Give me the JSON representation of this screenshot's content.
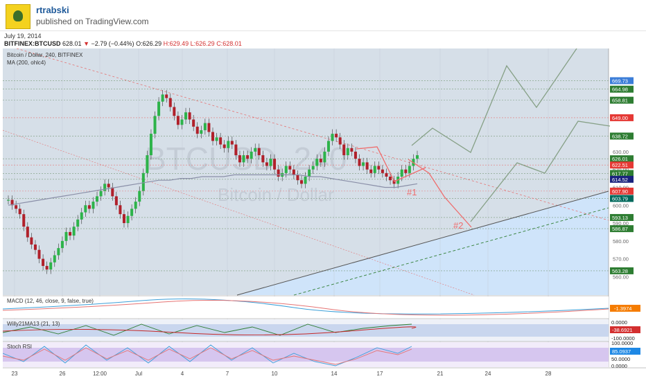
{
  "header": {
    "username": "rtrabski",
    "published": "published on TradingView.com"
  },
  "date": "July 19, 2014",
  "symbol_line": {
    "symbol": "BITFINEX:BTCUSD",
    "last": "628.01",
    "arrow": "▼",
    "change": "−2.79 (−0.44%)",
    "open": "O:626.29",
    "high": "H:629.49",
    "low": "L:626.29",
    "close": "C:628.01"
  },
  "main_pane": {
    "title": "Bitcoin / Dollar, 240, BITFINEX",
    "ma": "MA (200, ohlc4)",
    "watermark1": "BTCUSD, 240",
    "watermark2": "Bitcoin / Dollar"
  },
  "annotations": {
    "mark1": "#1",
    "mark2": "#2"
  },
  "price_axis": {
    "ticks": [
      "630.00",
      "620.00",
      "610.00",
      "600.00",
      "590.00",
      "580.00",
      "570.00",
      "560.00"
    ],
    "tags": [
      {
        "v": "669.73",
        "c": "#3b7dd8"
      },
      {
        "v": "664.98",
        "c": "#2e7d32"
      },
      {
        "v": "658.81",
        "c": "#2e7d32"
      },
      {
        "v": "649.00",
        "c": "#e53935"
      },
      {
        "v": "638.72",
        "c": "#2e7d32"
      },
      {
        "v": "626.01",
        "c": "#2e7d32"
      },
      {
        "v": "622.51",
        "c": "#e53935"
      },
      {
        "v": "617.77",
        "c": "#2e7d32"
      },
      {
        "v": "614.52",
        "c": "#1a237e"
      },
      {
        "v": "607.90",
        "c": "#e53935"
      },
      {
        "v": "603.79",
        "c": "#00695c"
      },
      {
        "v": "593.13",
        "c": "#2e7d32"
      },
      {
        "v": "586.87",
        "c": "#2e7d32"
      },
      {
        "v": "563.28",
        "c": "#2e7d32"
      }
    ]
  },
  "macd": {
    "title": "MACD (12, 46, close, 9, false, true)",
    "value": "-1.3974"
  },
  "willy": {
    "title": "Willy21MA13 (21, 13)",
    "v1": "0.0000",
    "v2": "-38.6921",
    "v3": "-100.0000"
  },
  "stoch": {
    "title": "Stoch RSI",
    "v1": "100.0000",
    "v2": "85.0937",
    "v3": "50.0000",
    "v4": "0.0000"
  },
  "time_axis": [
    "23",
    "26",
    "12:00",
    "Jul",
    "4",
    "7",
    "10",
    "14",
    "17",
    "21",
    "24",
    "28"
  ],
  "chart_data": {
    "type": "candlestick",
    "title": "Bitcoin / Dollar, 240, BITFINEX",
    "ylim": [
      552,
      680
    ],
    "close": [
      603,
      600,
      598,
      595,
      588,
      582,
      578,
      575,
      570,
      566,
      564,
      568,
      572,
      576,
      580,
      585,
      583,
      588,
      592,
      596,
      600,
      598,
      602,
      605,
      608,
      612,
      610,
      605,
      600,
      595,
      590,
      594,
      598,
      602,
      608,
      618,
      628,
      640,
      650,
      658,
      662,
      660,
      655,
      650,
      645,
      648,
      652,
      648,
      644,
      640,
      642,
      646,
      641,
      636,
      638,
      634,
      632,
      636,
      634,
      628,
      624,
      628,
      626,
      630,
      632,
      628,
      624,
      622,
      626,
      620,
      616,
      618,
      622,
      620,
      617,
      614,
      612,
      616,
      620,
      622,
      626,
      624,
      630,
      636,
      640,
      638,
      634,
      628,
      632,
      630,
      626,
      622,
      624,
      620,
      618,
      622,
      620,
      618,
      616,
      614,
      612,
      616,
      620,
      618,
      622,
      626,
      628
    ],
    "ma200": [
      600,
      601,
      602,
      603,
      604,
      605,
      606,
      607,
      608,
      609,
      610,
      611,
      612,
      613,
      614,
      614,
      615,
      615,
      616,
      616,
      616,
      617,
      617,
      617,
      617,
      617,
      617,
      617,
      616,
      616,
      615,
      614,
      613,
      612,
      611,
      610,
      610,
      611,
      612
    ],
    "levels": [
      669.73,
      664.98,
      658.81,
      649.0,
      638.72,
      626.01,
      622.51,
      617.77,
      614.52,
      607.9,
      603.79,
      593.13,
      586.87,
      563.28
    ]
  }
}
